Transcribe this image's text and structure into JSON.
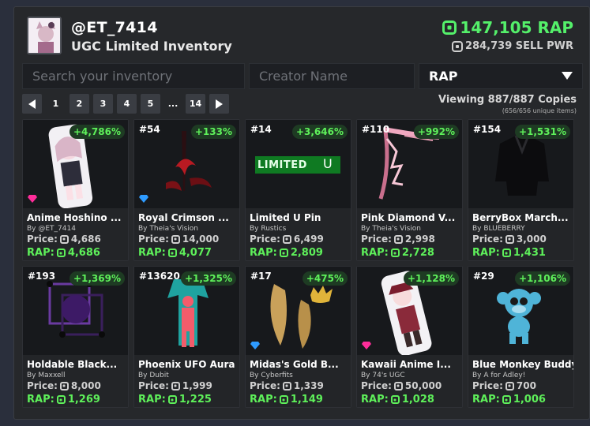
{
  "header": {
    "username": "@ET_7414",
    "subtitle": "UGC Limited Inventory",
    "rap_total": "147,105 RAP",
    "sell_power": "284,739 SELL PWR"
  },
  "search": {
    "inventory_placeholder": "Search your inventory",
    "creator_placeholder": "Creator Name",
    "sort_value": "RAP"
  },
  "pagination": {
    "pages": [
      "1",
      "2",
      "3",
      "4",
      "5",
      "...",
      "14"
    ],
    "current": "1"
  },
  "viewing": {
    "text": "Viewing 887/887 Copies",
    "unique": "(656/656 unique items)"
  },
  "labels": {
    "price": "Price:",
    "rap": "RAP:"
  },
  "items": [
    {
      "serial": "",
      "pct": "+4,786%",
      "name": "Anime Hoshino ...",
      "by": "By @ET_7414",
      "price": "4,686",
      "rap": "4,686",
      "gem": "pink"
    },
    {
      "serial": "#54",
      "pct": "+133%",
      "name": "Royal Crimson ...",
      "by": "By Theia's Vision",
      "price": "14,000",
      "rap": "4,077",
      "gem": "blue"
    },
    {
      "serial": "#14",
      "pct": "+3,646%",
      "name": "Limited U Pin",
      "by": "By Rustics",
      "price": "6,499",
      "rap": "2,809",
      "gem": "",
      "banner": "LIMITED",
      "banner_u": "U"
    },
    {
      "serial": "#110",
      "pct": "+992%",
      "name": "Pink Diamond V...",
      "by": "By Theia's Vision",
      "price": "2,998",
      "rap": "2,728",
      "gem": ""
    },
    {
      "serial": "#154",
      "pct": "+1,531%",
      "name": "BerryBox March...",
      "by": "By BLUEBERRY",
      "price": "3,000",
      "rap": "1,431",
      "gem": ""
    },
    {
      "serial": "#193",
      "pct": "+1,369%",
      "name": "Holdable Black...",
      "by": "By Maxxell",
      "price": "8,000",
      "rap": "1,269",
      "gem": ""
    },
    {
      "serial": "#13620",
      "pct": "+1,325%",
      "name": "Phoenix UFO Aura",
      "by": "By Dubit",
      "price": "1,999",
      "rap": "1,225",
      "gem": ""
    },
    {
      "serial": "#17",
      "pct": "+475%",
      "name": "Midas's Gold B...",
      "by": "By Cyberfits",
      "price": "1,339",
      "rap": "1,149",
      "gem": "blue"
    },
    {
      "serial": "",
      "pct": "+1,128%",
      "name": "Kawaii Anime I...",
      "by": "By 74's UGC",
      "price": "50,000",
      "rap": "1,028",
      "gem": "pink"
    },
    {
      "serial": "#29",
      "pct": "+1,106%",
      "name": "Blue Monkey Buddy",
      "by": "By A for Adley!",
      "price": "700",
      "rap": "1,006",
      "gem": ""
    }
  ],
  "colors": {
    "accent_green": "#5ef05a",
    "gem_pink": "#ff2d9a",
    "gem_blue": "#2e9bff"
  }
}
